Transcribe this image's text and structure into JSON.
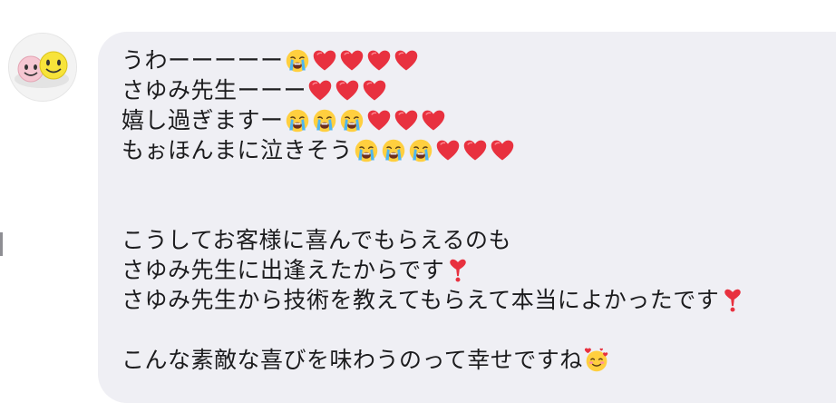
{
  "sender": {
    "avatar_icon": "smiley-stickers-avatar-icon"
  },
  "message": {
    "lines": [
      {
        "text": "うわーーーーー",
        "emojis": [
          "crying-face",
          "heart",
          "heart",
          "heart",
          "heart"
        ]
      },
      {
        "text": "さゆみ先生ーーー",
        "emojis": [
          "heart",
          "heart",
          "heart"
        ]
      },
      {
        "text": "嬉し過ぎますー",
        "emojis": [
          "crying-face",
          "crying-face",
          "crying-face",
          "heart",
          "heart",
          "heart"
        ]
      },
      {
        "text": "もぉほんまに泣きそう",
        "emojis": [
          "crying-face",
          "crying-face",
          "crying-face",
          "heart",
          "heart",
          "heart"
        ]
      },
      {
        "text": "",
        "emojis": []
      },
      {
        "text": "",
        "emojis": []
      },
      {
        "text": "こうしてお客様に喜んでもらえるのも",
        "emojis": []
      },
      {
        "text": "さゆみ先生に出逢えたからです",
        "emojis": [
          "exclamation-heart"
        ]
      },
      {
        "text": "さゆみ先生から技術を教えてもらえて本当によかったです",
        "emojis": [
          "exclamation-heart"
        ]
      },
      {
        "text": "",
        "emojis": []
      },
      {
        "text": "こんな素敵な喜びを味わうのって幸せですね",
        "emojis": [
          "smiling-face-with-hearts"
        ]
      }
    ]
  },
  "colors": {
    "bubble": "#efeff4",
    "text": "#1c1c1e",
    "heart": "#e8313f"
  }
}
